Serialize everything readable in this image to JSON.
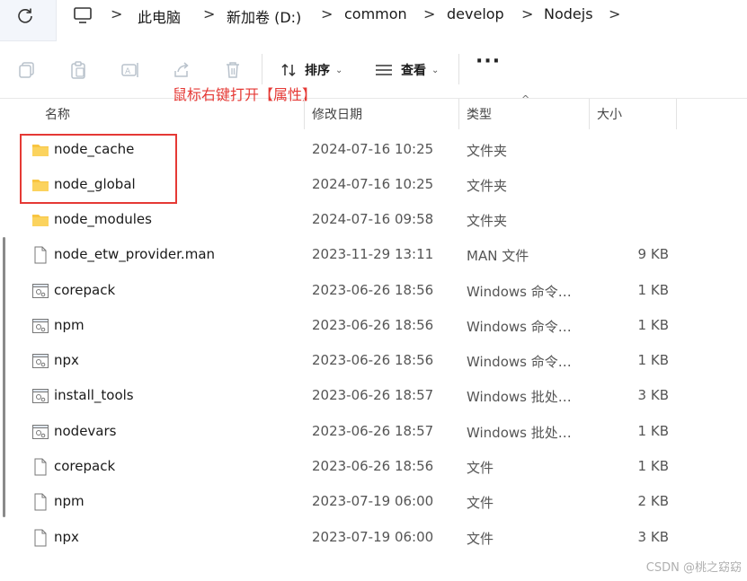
{
  "address_bar": {
    "refresh_icon": "refresh-icon",
    "computer_icon": "computer-icon",
    "crumbs": [
      "此电脑",
      "新加卷 (D:)",
      "common",
      "develop",
      "Nodejs"
    ],
    "separator": ">"
  },
  "toolbar": {
    "icons": [
      "copy-icon",
      "paste-icon",
      "rename-icon",
      "share-icon",
      "delete-icon"
    ],
    "sort_label": "排序",
    "view_label": "查看",
    "more_label": "···"
  },
  "annotation": "鼠标右键打开【属性】",
  "columns": {
    "name": "名称",
    "modified": "修改日期",
    "type": "类型",
    "size": "大小",
    "sort_indicator": "^"
  },
  "files": [
    {
      "icon": "folder-icon",
      "name": "node_cache",
      "modified": "2024-07-16 10:25",
      "type": "文件夹",
      "size": ""
    },
    {
      "icon": "folder-icon",
      "name": "node_global",
      "modified": "2024-07-16 10:25",
      "type": "文件夹",
      "size": ""
    },
    {
      "icon": "folder-icon",
      "name": "node_modules",
      "modified": "2024-07-16 09:58",
      "type": "文件夹",
      "size": ""
    },
    {
      "icon": "file-icon",
      "name": "node_etw_provider.man",
      "modified": "2023-11-29 13:11",
      "type": "MAN 文件",
      "size": "9 KB"
    },
    {
      "icon": "script-icon",
      "name": "corepack",
      "modified": "2023-06-26 18:56",
      "type": "Windows 命令脚本",
      "size": "1 KB"
    },
    {
      "icon": "script-icon",
      "name": "npm",
      "modified": "2023-06-26 18:56",
      "type": "Windows 命令脚本",
      "size": "1 KB"
    },
    {
      "icon": "script-icon",
      "name": "npx",
      "modified": "2023-06-26 18:56",
      "type": "Windows 命令脚本",
      "size": "1 KB"
    },
    {
      "icon": "script-icon",
      "name": "install_tools",
      "modified": "2023-06-26 18:57",
      "type": "Windows 批处理...",
      "size": "3 KB"
    },
    {
      "icon": "script-icon",
      "name": "nodevars",
      "modified": "2023-06-26 18:57",
      "type": "Windows 批处理...",
      "size": "1 KB"
    },
    {
      "icon": "file-icon",
      "name": "corepack",
      "modified": "2023-06-26 18:56",
      "type": "文件",
      "size": "1 KB"
    },
    {
      "icon": "file-icon",
      "name": "npm",
      "modified": "2023-07-19 06:00",
      "type": "文件",
      "size": "2 KB"
    },
    {
      "icon": "file-icon",
      "name": "npx",
      "modified": "2023-07-19 06:00",
      "type": "文件",
      "size": "3 KB"
    }
  ],
  "watermark": "CSDN @桃之窈窈",
  "colors": {
    "annotation": "#e53935",
    "folder": "#f8c542"
  }
}
